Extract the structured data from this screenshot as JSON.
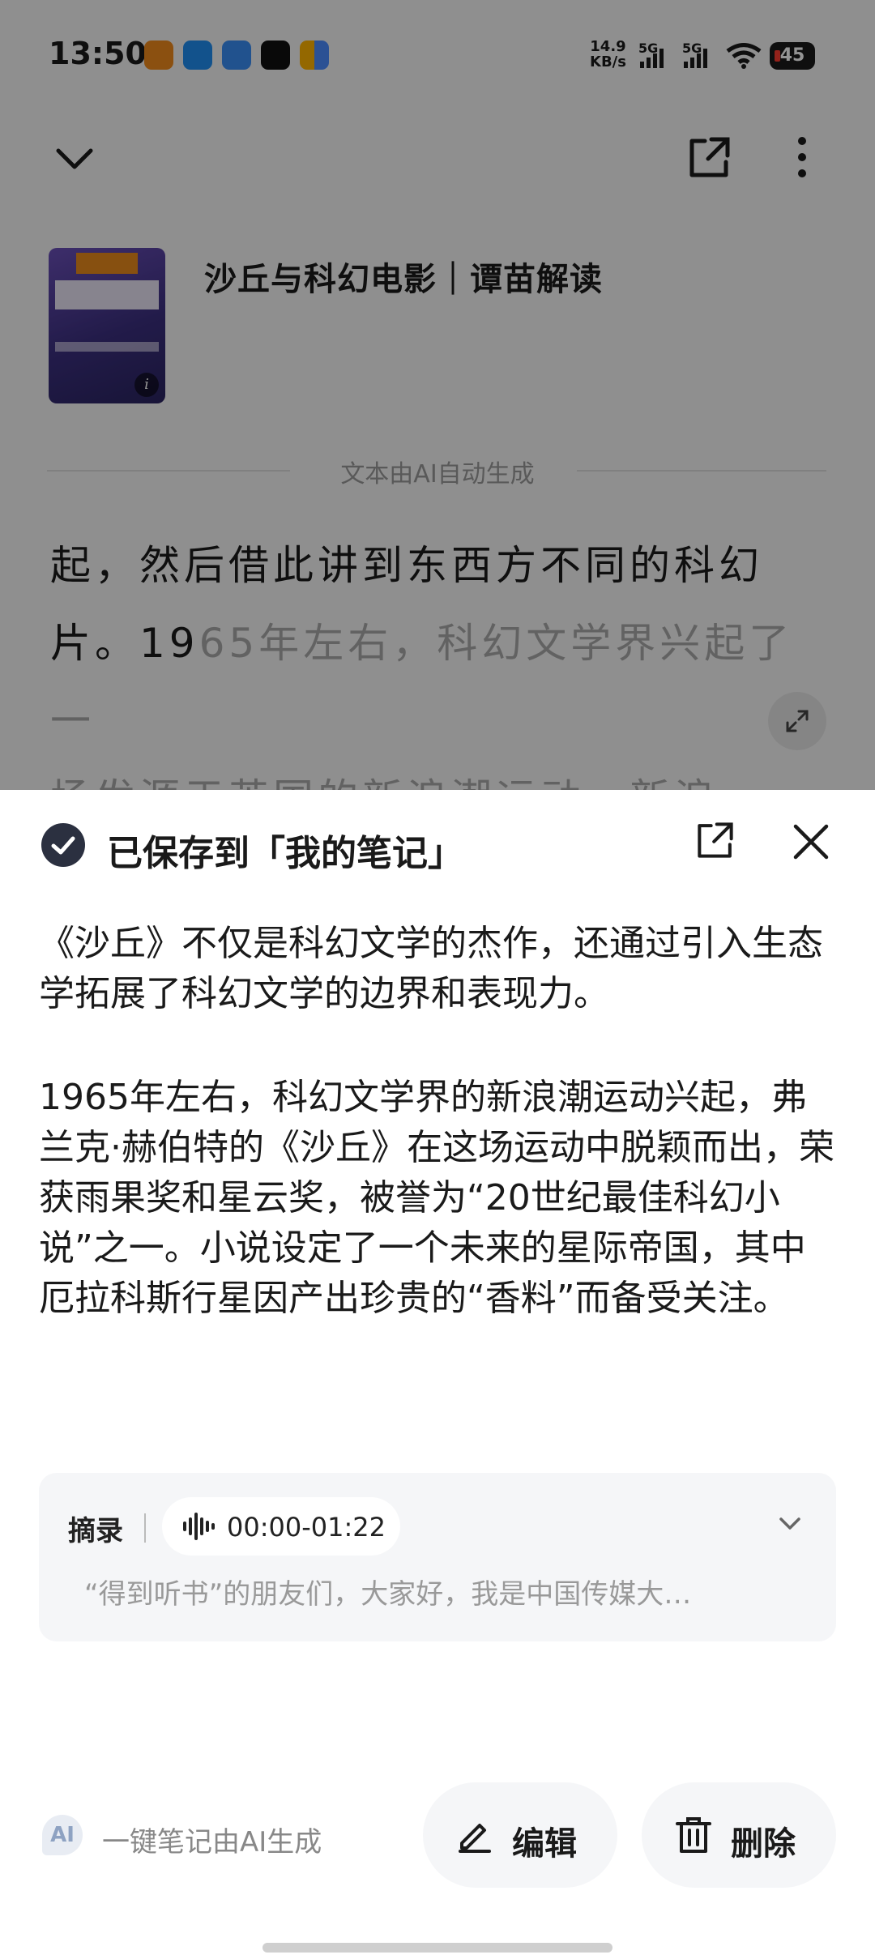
{
  "status": {
    "time": "13:50",
    "net_speed_value": "14.9",
    "net_speed_unit": "KB/s",
    "sig1": "5G",
    "sig2": "5G",
    "battery": "45"
  },
  "book": {
    "title": "沙丘与科幻电影｜谭苗解读"
  },
  "article": {
    "ai_label": "文本由AI自动生成",
    "line1": "起，然后借此讲到东西方不同的科幻",
    "line2_a": "片。19",
    "line2_b": "65年左右，科幻文学界兴起了一",
    "line3": "场发源于英国的新浪潮运动。新浪"
  },
  "sheet": {
    "title": "已保存到「我的笔记」",
    "para1": "《沙丘》不仅是科幻文学的杰作，还通过引入生态学拓展了科幻文学的边界和表现力。",
    "para2": "1965年左右，科幻文学界的新浪潮运动兴起，弗兰克·赫伯特的《沙丘》在这场运动中脱颖而出，荣获雨果奖和星云奖，被誉为“20世纪最佳科幻小说”之一。小说设定了一个未来的星际帝国，其中厄拉科斯行星因产出珍贵的“香料”而备受关注。",
    "excerpt_label": "摘录",
    "audio_time": "00:00-01:22",
    "excerpt_text": "“得到听书”的朋友们，大家好，我是中国传媒大…",
    "ai_badge": "AI",
    "ai_note": "一键笔记由AI生成",
    "edit_label": "编辑",
    "delete_label": "删除"
  },
  "icons": {
    "collapse": "chevron-down-icon",
    "share": "share-icon",
    "more": "more-vertical-icon",
    "expand": "expand-icon",
    "check": "check-circle-icon",
    "close": "close-icon",
    "audio": "waveform-icon",
    "edit": "pen-icon",
    "delete": "trash-icon"
  },
  "colors": {
    "check_bg": "#2b3040",
    "button_bg": "#f5f6f8",
    "muted_text": "#999999"
  }
}
